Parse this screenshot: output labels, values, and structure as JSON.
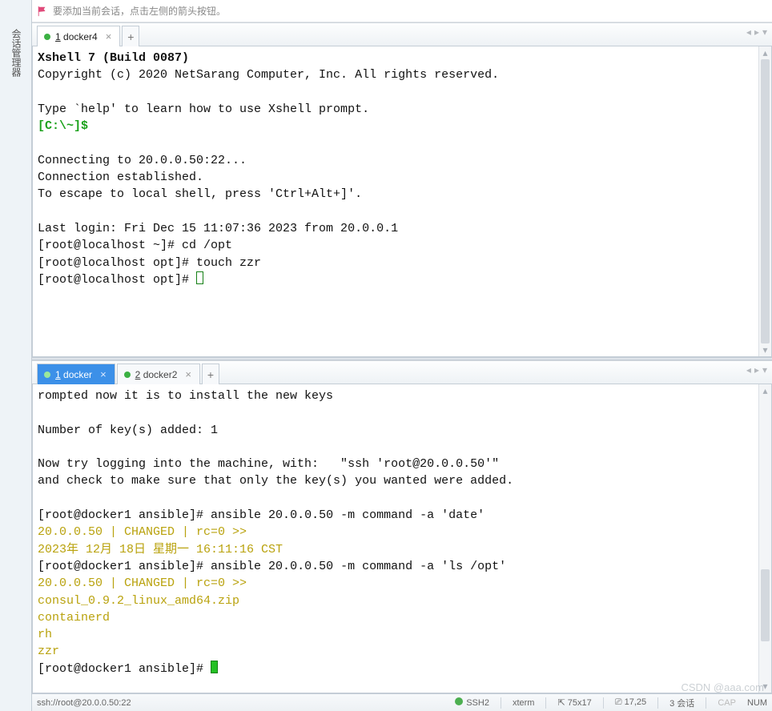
{
  "hint": "要添加当前会话，点击左侧的箭头按钮。",
  "sidebar_label": "会话管理器",
  "pane1": {
    "tab": {
      "label": "docker4",
      "mnemonic": "1"
    },
    "lines": {
      "l0": "Xshell 7 (Build 0087)",
      "l1": "Copyright (c) 2020 NetSarang Computer, Inc. All rights reserved.",
      "l2": "",
      "l3": "Type `help' to learn how to use Xshell prompt.",
      "l4": "[C:\\~]$ ",
      "l5": "",
      "l6": "Connecting to 20.0.0.50:22...",
      "l7": "Connection established.",
      "l8": "To escape to local shell, press 'Ctrl+Alt+]'.",
      "l9": "",
      "l10": "Last login: Fri Dec 15 11:07:36 2023 from 20.0.0.1",
      "l11": "[root@localhost ~]# ",
      "c11": "cd /opt",
      "l12": "[root@localhost opt]# ",
      "c12": "touch zzr",
      "l13": "[root@localhost opt]# "
    }
  },
  "pane2": {
    "tab1": {
      "label": "docker",
      "mnemonic": "1"
    },
    "tab2": {
      "label": "docker2",
      "mnemonic": "2"
    },
    "lines": {
      "l0": "rompted now it is to install the new keys",
      "l1": "",
      "l2": "Number of key(s) added: 1",
      "l3": "",
      "l4": "Now try logging into the machine, with:   \"ssh 'root@20.0.0.50'\"",
      "l5": "and check to make sure that only the key(s) you wanted were added.",
      "l6": "",
      "l7": "[root@docker1 ansible]# ",
      "c7": "ansible 20.0.0.50 -m command -a 'date'",
      "l8": "20.0.0.50 | CHANGED | rc=0 >>",
      "l9": "2023年 12月 18日 星期一 16:11:16 CST",
      "l10": "[root@docker1 ansible]# ",
      "c10": "ansible 20.0.0.50 -m command -a 'ls /opt'",
      "l11": "20.0.0.50 | CHANGED | rc=0 >>",
      "l12": "consul_0.9.2_linux_amd64.zip",
      "l13": "containerd",
      "l14": "rh",
      "l15": "zzr",
      "l16": "[root@docker1 ansible]# "
    }
  },
  "status": {
    "url": "ssh://root@20.0.0.50:22",
    "proto": "SSH2",
    "termtype": "xterm",
    "size": "75x17",
    "rc": "17,25",
    "sess": "3 会话",
    "cap": "CAP",
    "num": "NUM"
  },
  "watermark": "CSDN @aaa.com"
}
